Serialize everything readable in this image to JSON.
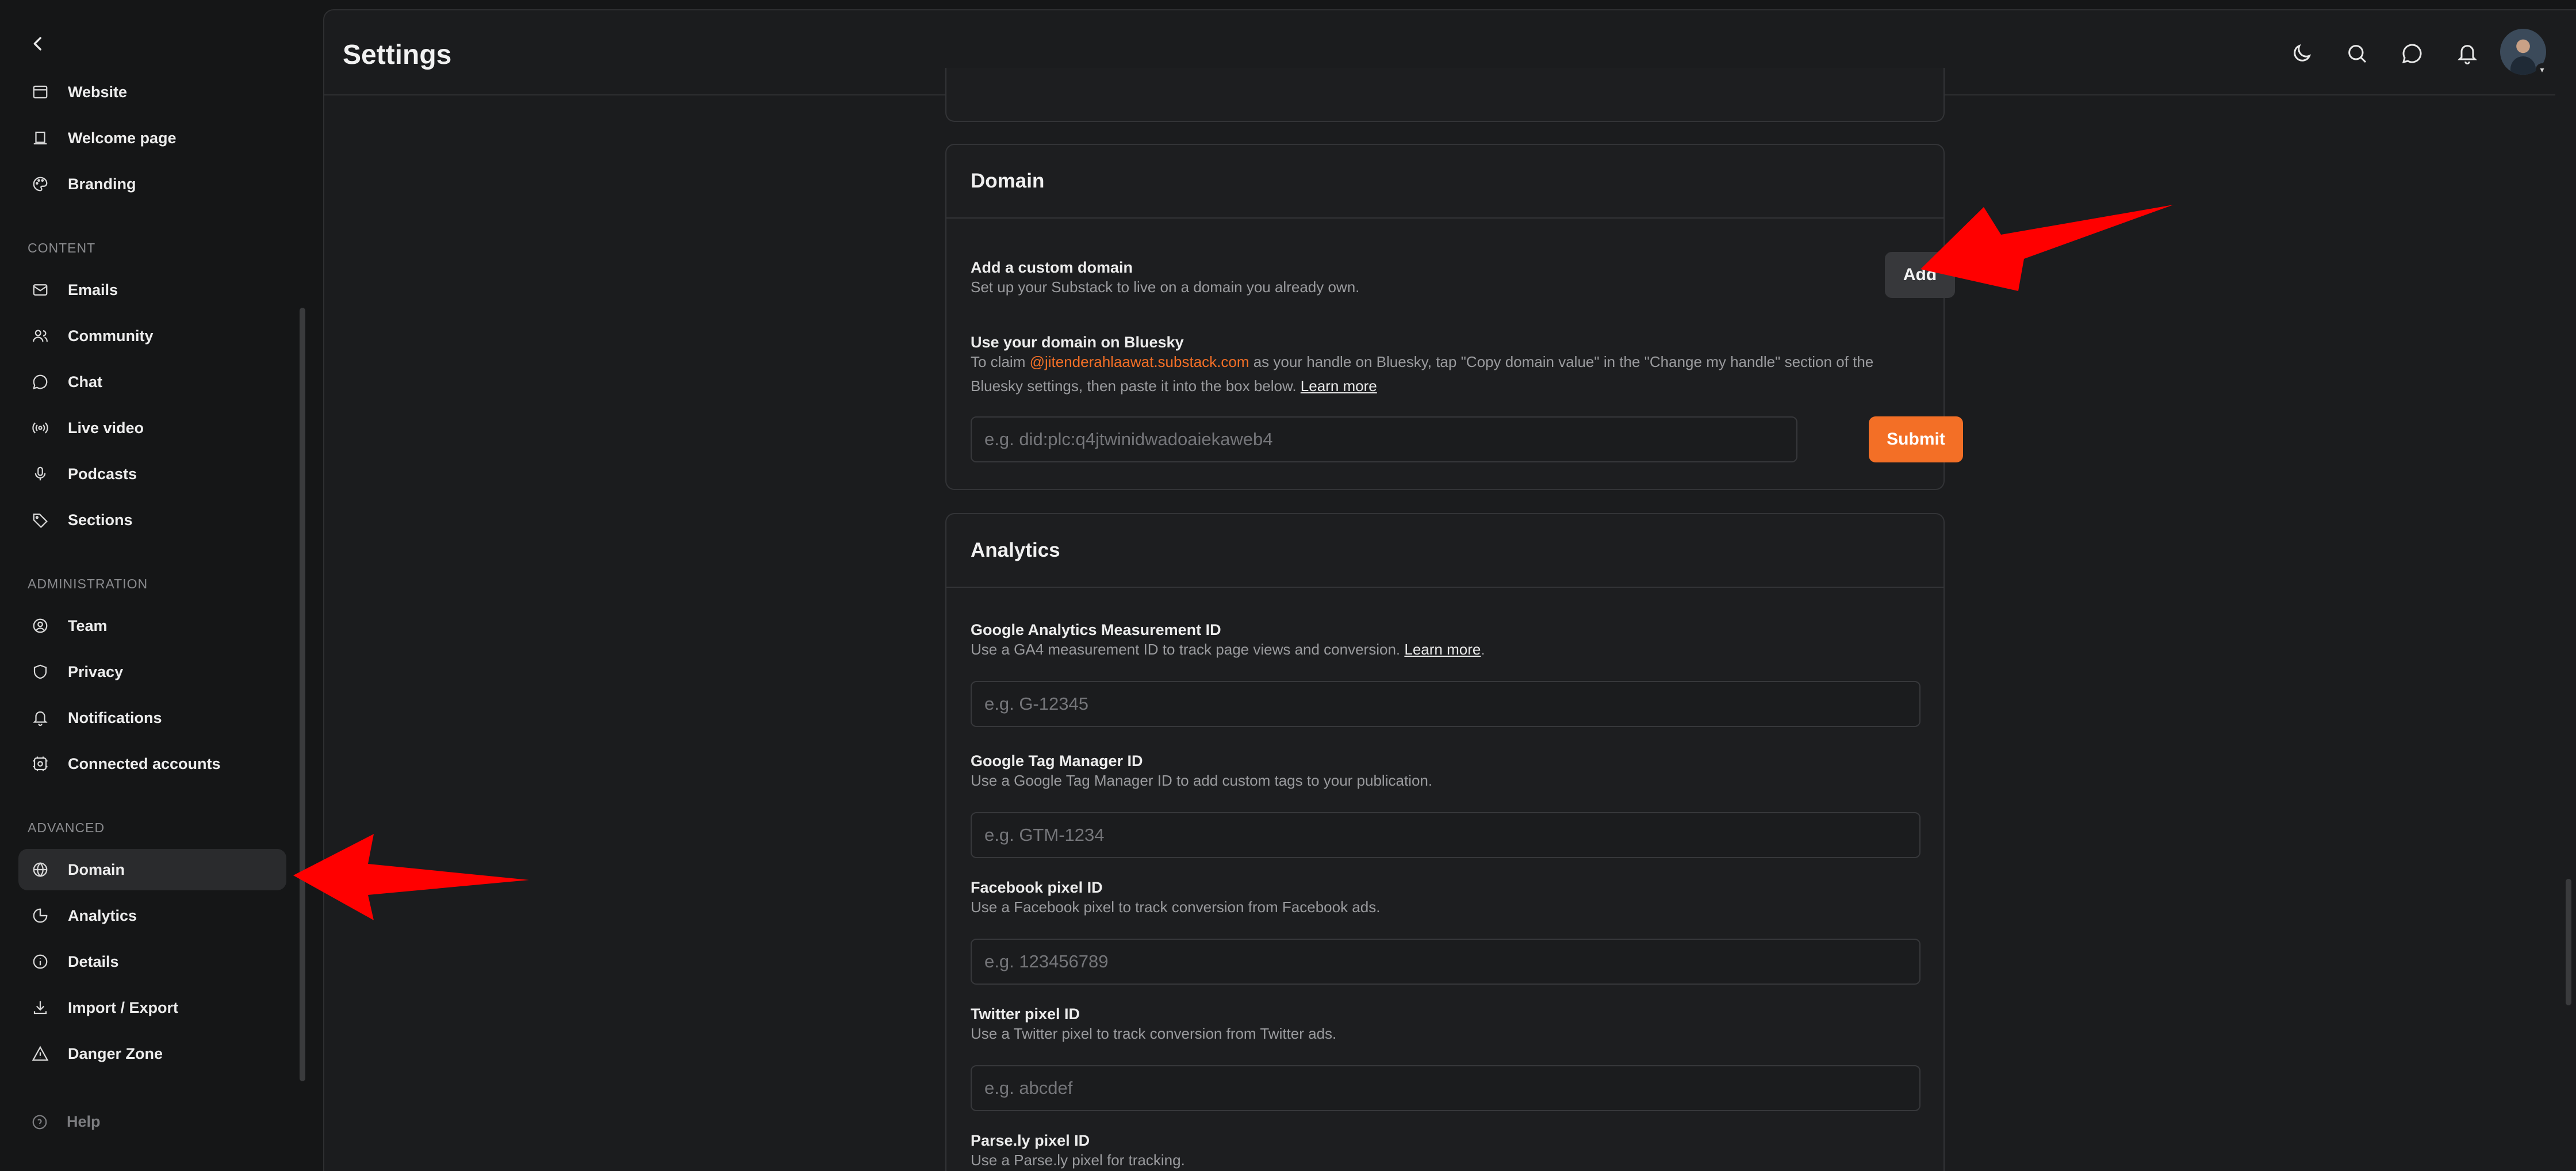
{
  "sidebar": {
    "items_top": [
      {
        "label": "Website",
        "icon": "browser-window-icon"
      },
      {
        "label": "Welcome page",
        "icon": "welcome-page-icon"
      },
      {
        "label": "Branding",
        "icon": "palette-icon"
      }
    ],
    "content_head": "CONTENT",
    "items_content": [
      {
        "label": "Emails",
        "icon": "mail-icon"
      },
      {
        "label": "Community",
        "icon": "people-icon"
      },
      {
        "label": "Chat",
        "icon": "chat-icon"
      },
      {
        "label": "Live video",
        "icon": "broadcast-icon"
      },
      {
        "label": "Podcasts",
        "icon": "microphone-icon"
      },
      {
        "label": "Sections",
        "icon": "tag-icon"
      }
    ],
    "admin_head": "ADMINISTRATION",
    "items_admin": [
      {
        "label": "Team",
        "icon": "user-circle-icon"
      },
      {
        "label": "Privacy",
        "icon": "shield-icon"
      },
      {
        "label": "Notifications",
        "icon": "bell-icon"
      },
      {
        "label": "Connected accounts",
        "icon": "connected-icon"
      }
    ],
    "advanced_head": "ADVANCED",
    "items_advanced": [
      {
        "label": "Domain",
        "icon": "globe-icon",
        "active": true
      },
      {
        "label": "Analytics",
        "icon": "pie-chart-icon"
      },
      {
        "label": "Details",
        "icon": "info-icon"
      },
      {
        "label": "Import / Export",
        "icon": "download-icon"
      },
      {
        "label": "Danger Zone",
        "icon": "warning-icon"
      }
    ],
    "help": "Help"
  },
  "header": {
    "title": "Settings"
  },
  "domain": {
    "title": "Domain",
    "custom_title": "Add a custom domain",
    "custom_desc": "Set up your Substack to live on a domain you already own.",
    "add_label": "Add",
    "bluesky_title": "Use your domain on Bluesky",
    "bluesky_desc_1": "To claim ",
    "bluesky_handle": "@jitenderahlaawat.substack.com",
    "bluesky_desc_2": " as your handle on Bluesky, tap \"Copy domain value\" in the \"Change my handle\" section of the",
    "bluesky_desc_3": "Bluesky settings, then paste it into the box below. ",
    "learn_more": "Learn more",
    "bluesky_placeholder": "e.g. did:plc:q4jtwinidwadoaiekaweb4",
    "submit_label": "Submit"
  },
  "analytics": {
    "title": "Analytics",
    "ga_title": "Google Analytics Measurement ID",
    "ga_desc": "Use a GA4 measurement ID to track page views and conversion. ",
    "ga_learn_more": "Learn more",
    "ga_period": ".",
    "ga_placeholder": "e.g. G-12345",
    "gtm_title": "Google Tag Manager ID",
    "gtm_desc": "Use a Google Tag Manager ID to add custom tags to your publication.",
    "gtm_placeholder": "e.g. GTM-1234",
    "fb_title": "Facebook pixel ID",
    "fb_desc": "Use a Facebook pixel to track conversion from Facebook ads.",
    "fb_placeholder": "e.g. 123456789",
    "tw_title": "Twitter pixel ID",
    "tw_desc": "Use a Twitter pixel to track conversion from Twitter ads.",
    "tw_placeholder": "e.g. abcdef",
    "parsely_title": "Parse.ly pixel ID",
    "parsely_desc": "Use a Parse.ly pixel for tracking."
  },
  "colors": {
    "accent": "#f36f26",
    "annotation": "#ff0000"
  }
}
